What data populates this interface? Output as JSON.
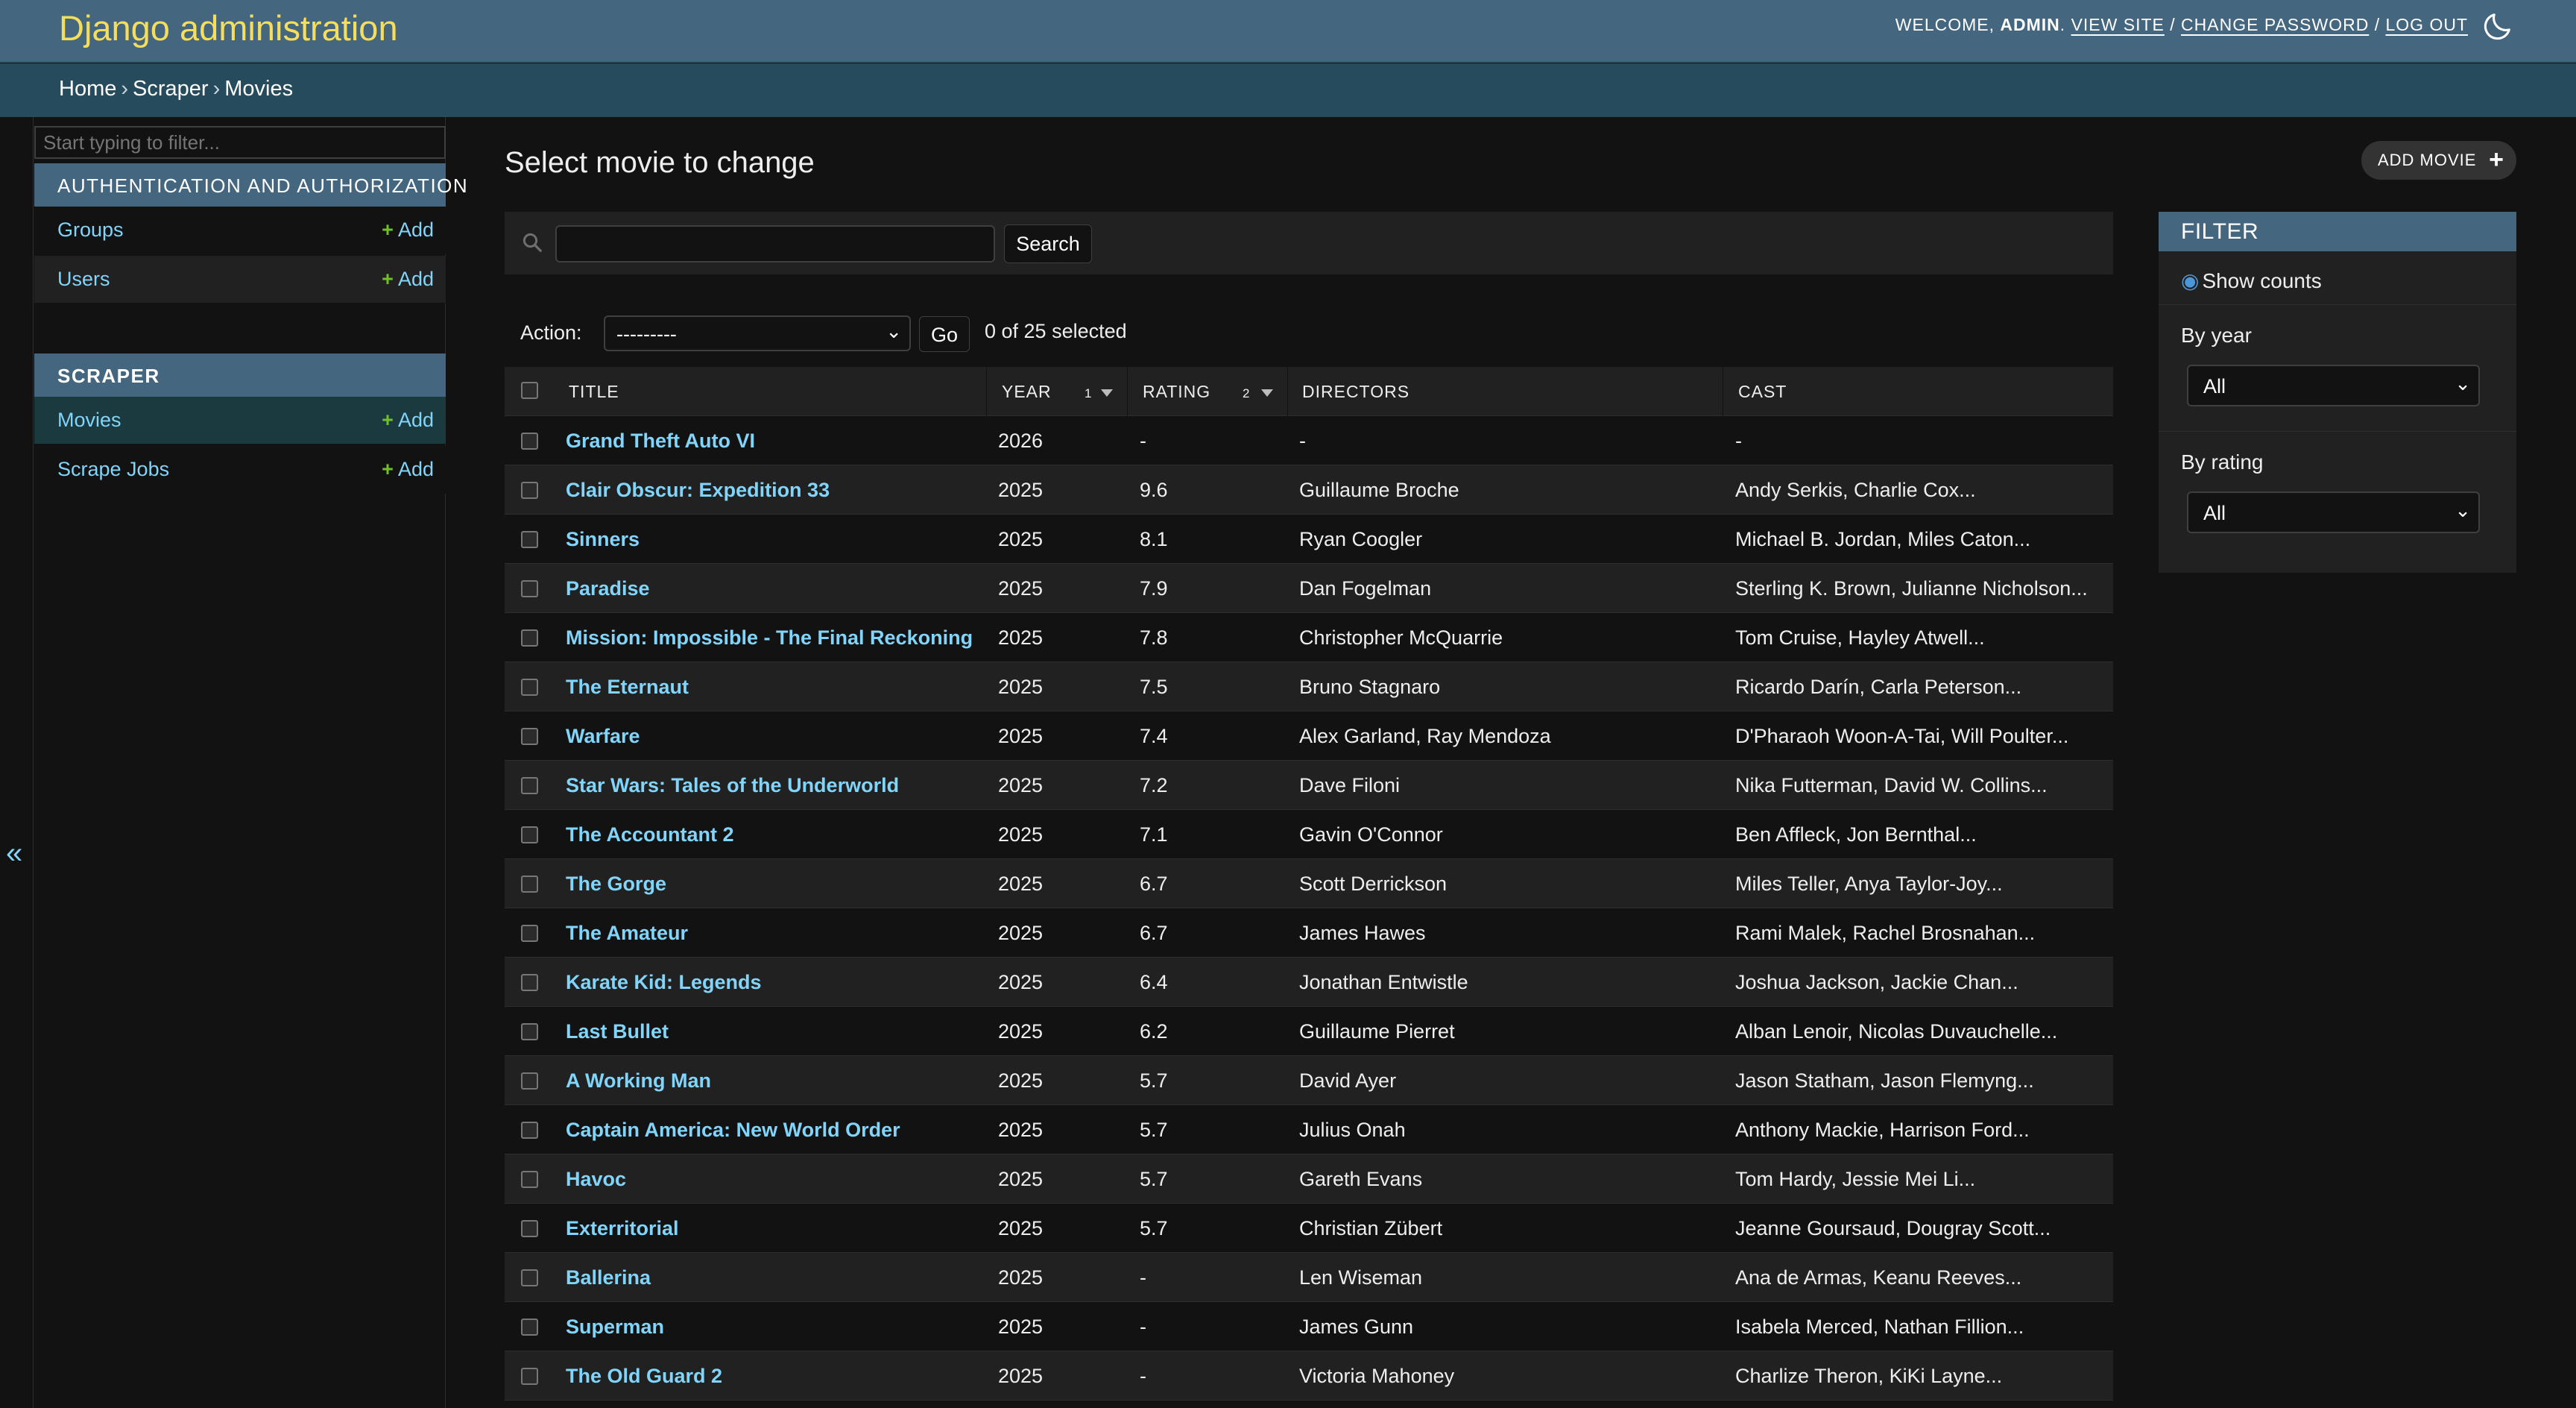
{
  "header": {
    "branding": "Django administration",
    "welcome": "WELCOME, ",
    "username": "ADMIN",
    "period": ". ",
    "view_site": "VIEW SITE",
    "sep1": " / ",
    "change_password": "CHANGE PASSWORD",
    "sep2": " / ",
    "log_out": "LOG OUT"
  },
  "breadcrumbs": [
    "Home",
    "Scraper",
    "Movies"
  ],
  "breadcrumb_separator": "›",
  "sidebar": {
    "filter_placeholder": "Start typing to filter...",
    "apps": [
      {
        "caption": "AUTHENTICATION AND AUTHORIZATION",
        "models": [
          {
            "label": "Groups",
            "add": "Add"
          },
          {
            "label": "Users",
            "add": "Add"
          }
        ]
      },
      {
        "caption": "SCRAPER",
        "models": [
          {
            "label": "Movies",
            "add": "Add",
            "current": true
          },
          {
            "label": "Scrape Jobs",
            "add": "Add"
          }
        ]
      }
    ],
    "collapse_glyph": "«"
  },
  "content": {
    "title": "Select movie to change",
    "add_button": "ADD MOVIE",
    "search_button": "Search",
    "action_label": "Action:",
    "action_value": "---------",
    "go_button": "Go",
    "selected_count": "0 of 25 selected"
  },
  "table": {
    "columns": {
      "title": "TITLE",
      "year": "YEAR",
      "year_sort_priority": "1",
      "rating": "RATING",
      "rating_sort_priority": "2",
      "directors": "DIRECTORS",
      "cast": "CAST"
    },
    "rows": [
      {
        "title": "Grand Theft Auto VI",
        "year": "2026",
        "rating": "-",
        "directors": "-",
        "cast": "-"
      },
      {
        "title": "Clair Obscur: Expedition 33",
        "year": "2025",
        "rating": "9.6",
        "directors": "Guillaume Broche",
        "cast": "Andy Serkis, Charlie Cox..."
      },
      {
        "title": "Sinners",
        "year": "2025",
        "rating": "8.1",
        "directors": "Ryan Coogler",
        "cast": "Michael B. Jordan, Miles Caton..."
      },
      {
        "title": "Paradise",
        "year": "2025",
        "rating": "7.9",
        "directors": "Dan Fogelman",
        "cast": "Sterling K. Brown, Julianne Nicholson..."
      },
      {
        "title": "Mission: Impossible - The Final Reckoning",
        "year": "2025",
        "rating": "7.8",
        "directors": "Christopher McQuarrie",
        "cast": "Tom Cruise, Hayley Atwell..."
      },
      {
        "title": "The Eternaut",
        "year": "2025",
        "rating": "7.5",
        "directors": "Bruno Stagnaro",
        "cast": "Ricardo Darín, Carla Peterson..."
      },
      {
        "title": "Warfare",
        "year": "2025",
        "rating": "7.4",
        "directors": "Alex Garland, Ray Mendoza",
        "cast": "D'Pharaoh Woon-A-Tai, Will Poulter..."
      },
      {
        "title": "Star Wars: Tales of the Underworld",
        "year": "2025",
        "rating": "7.2",
        "directors": "Dave Filoni",
        "cast": "Nika Futterman, David W. Collins..."
      },
      {
        "title": "The Accountant 2",
        "year": "2025",
        "rating": "7.1",
        "directors": "Gavin O'Connor",
        "cast": "Ben Affleck, Jon Bernthal..."
      },
      {
        "title": "The Gorge",
        "year": "2025",
        "rating": "6.7",
        "directors": "Scott Derrickson",
        "cast": "Miles Teller, Anya Taylor-Joy..."
      },
      {
        "title": "The Amateur",
        "year": "2025",
        "rating": "6.7",
        "directors": "James Hawes",
        "cast": "Rami Malek, Rachel Brosnahan..."
      },
      {
        "title": "Karate Kid: Legends",
        "year": "2025",
        "rating": "6.4",
        "directors": "Jonathan Entwistle",
        "cast": "Joshua Jackson, Jackie Chan..."
      },
      {
        "title": "Last Bullet",
        "year": "2025",
        "rating": "6.2",
        "directors": "Guillaume Pierret",
        "cast": "Alban Lenoir, Nicolas Duvauchelle..."
      },
      {
        "title": "A Working Man",
        "year": "2025",
        "rating": "5.7",
        "directors": "David Ayer",
        "cast": "Jason Statham, Jason Flemyng..."
      },
      {
        "title": "Captain America: New World Order",
        "year": "2025",
        "rating": "5.7",
        "directors": "Julius Onah",
        "cast": "Anthony Mackie, Harrison Ford..."
      },
      {
        "title": "Havoc",
        "year": "2025",
        "rating": "5.7",
        "directors": "Gareth Evans",
        "cast": "Tom Hardy, Jessie Mei Li..."
      },
      {
        "title": "Exterritorial",
        "year": "2025",
        "rating": "5.7",
        "directors": "Christian Zübert",
        "cast": "Jeanne Goursaud, Dougray Scott..."
      },
      {
        "title": "Ballerina",
        "year": "2025",
        "rating": "-",
        "directors": "Len Wiseman",
        "cast": "Ana de Armas, Keanu Reeves..."
      },
      {
        "title": "Superman",
        "year": "2025",
        "rating": "-",
        "directors": "James Gunn",
        "cast": "Isabela Merced, Nathan Fillion..."
      },
      {
        "title": "The Old Guard 2",
        "year": "2025",
        "rating": "-",
        "directors": "Victoria Mahoney",
        "cast": "Charlize Theron, KiKi Layne..."
      }
    ]
  },
  "filter": {
    "title": "FILTER",
    "show_counts": "Show counts",
    "by_year_label": "By year",
    "by_year_value": "All",
    "by_rating_label": "By rating",
    "by_rating_value": "All"
  },
  "colors": {
    "header_bg": "#44667f",
    "breadcrumb_bg": "#264b5d",
    "branding": "#f5dd5d",
    "link": "#81d4fa",
    "add_plus": "#70bf2b",
    "current_model_bg": "#1b3a3f"
  }
}
